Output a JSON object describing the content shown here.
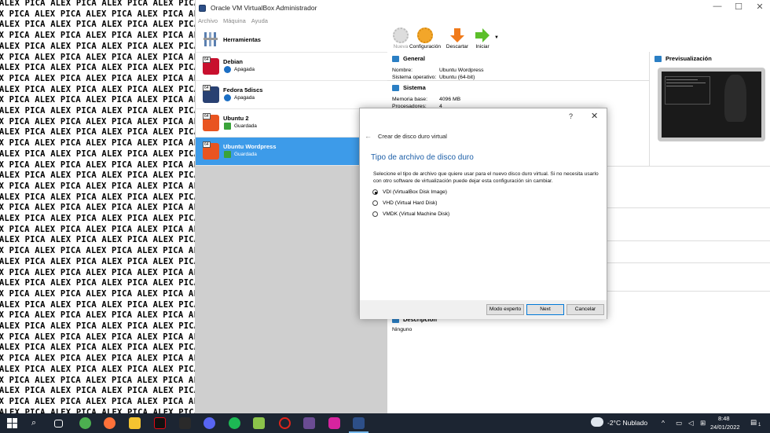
{
  "desktop_text": "ALEX PICA ALEX PICA ALEX PICA ALEX PICA ALEX",
  "window": {
    "title": "Oracle VM VirtualBox Administrador",
    "minimize": "—",
    "maximize": "☐",
    "close": "✕"
  },
  "menu": [
    "Archivo",
    "Máquina",
    "Ayuda"
  ],
  "tools_label": "Herramientas",
  "vms": [
    {
      "name": "Debian",
      "state": "Apagada",
      "badge": "64",
      "color": "#c8102e"
    },
    {
      "name": "Fedora 5discs",
      "state": "Apagada",
      "badge": "64",
      "color": "#294172"
    },
    {
      "name": "Ubuntu 2",
      "state": "Guardada",
      "badge": "64",
      "color": "#e95420"
    },
    {
      "name": "Ubuntu Wordpress",
      "state": "Guardada",
      "badge": "64",
      "color": "#e95420"
    }
  ],
  "toolbar": {
    "new": "Nueva",
    "settings": "Configuración",
    "discard": "Descartar",
    "start": "Iniciar"
  },
  "details": {
    "general": {
      "heading": "General",
      "rows": [
        {
          "k": "Nombre:",
          "v": "Ubuntu Wordpress"
        },
        {
          "k": "Sistema operativo:",
          "v": "Ubuntu (64-bit)"
        }
      ]
    },
    "system": {
      "heading": "Sistema",
      "rows": [
        {
          "k": "Memoria base:",
          "v": "4096 MB"
        },
        {
          "k": "Procesadores:",
          "v": "4"
        }
      ]
    },
    "preview_heading": "Previsualización",
    "description_heading": "Descripción",
    "description_value": "Ninguno"
  },
  "dialog": {
    "help": "?",
    "close": "✕",
    "back": "←",
    "title": "Crear de disco duro virtual",
    "heading": "Tipo de archivo de disco duro",
    "description": "Selecione el tipo de archivo que quiere usar para el nuevo disco duro virtual. Si no necesita usarlo con otro software de virtualización puede dejar esta configuración sin cambiar.",
    "options": [
      {
        "label": "VDI (VirtualBox Disk Image)",
        "selected": true
      },
      {
        "label": "VHD (Virtual Hard Disk)",
        "selected": false
      },
      {
        "label": "VMDK (Virtual Machine Disk)",
        "selected": false
      }
    ],
    "buttons": {
      "expert": "Modo experto",
      "next": "Next",
      "cancel": "Cancelar"
    }
  },
  "taskbar": {
    "weather": "-2°C  Nublado",
    "time": "8:48",
    "date": "24/01/2022",
    "notifications": "1"
  }
}
